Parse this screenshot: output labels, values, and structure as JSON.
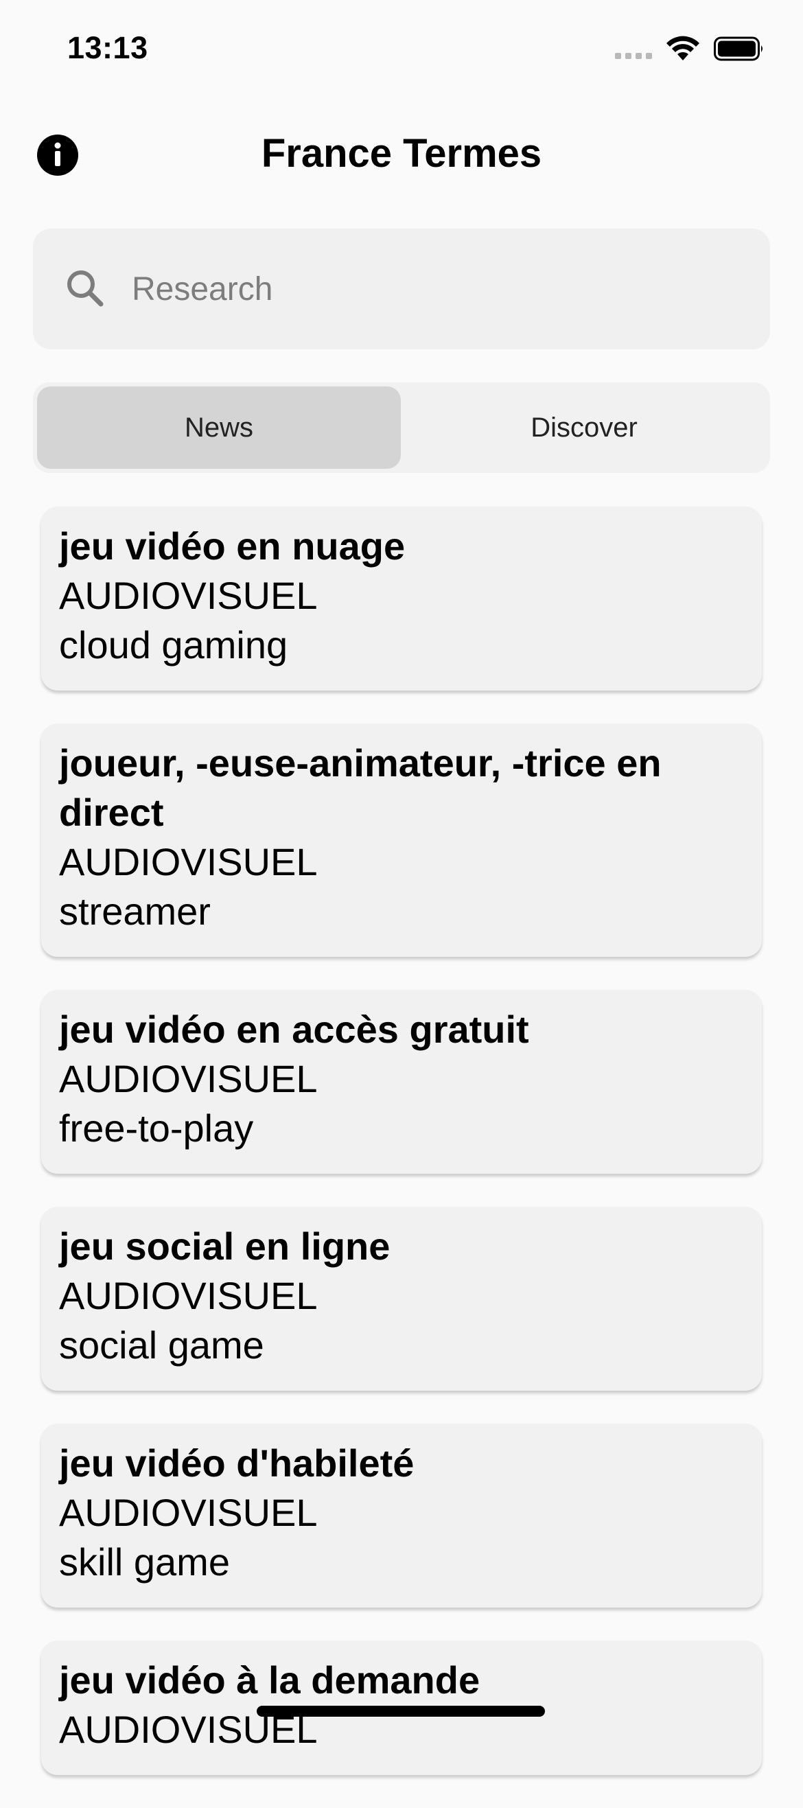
{
  "status": {
    "time": "13:13"
  },
  "header": {
    "title": "France Termes"
  },
  "search": {
    "placeholder": "Research"
  },
  "tabs": [
    {
      "label": "News",
      "active": true
    },
    {
      "label": "Discover",
      "active": false
    }
  ],
  "terms": [
    {
      "title": "jeu vidéo en nuage",
      "domain": "AUDIOVISUEL",
      "english": "cloud gaming"
    },
    {
      "title": "joueur, -euse-animateur, -trice en direct",
      "domain": "AUDIOVISUEL",
      "english": "streamer"
    },
    {
      "title": "jeu vidéo en accès gratuit",
      "domain": "AUDIOVISUEL",
      "english": "free-to-play"
    },
    {
      "title": "jeu social en ligne",
      "domain": "AUDIOVISUEL",
      "english": "social game"
    },
    {
      "title": "jeu vidéo d'habileté",
      "domain": "AUDIOVISUEL",
      "english": "skill game"
    },
    {
      "title": "jeu vidéo à la demande",
      "domain": "AUDIOVISUEL",
      "english": ""
    }
  ]
}
